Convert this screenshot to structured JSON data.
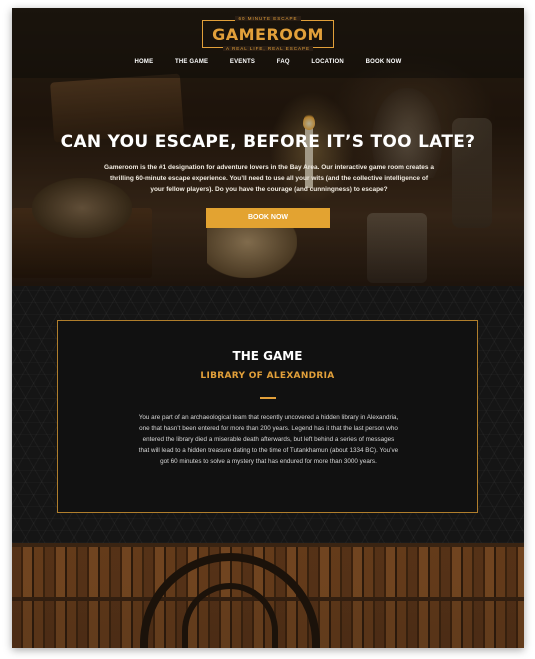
{
  "brand": {
    "tagline_top": "60 MINUTE ESCAPE",
    "name": "GAMEROOM",
    "tagline_bottom": "A REAL LIFE, REAL ESCAPE"
  },
  "nav": {
    "items": [
      "HOME",
      "THE GAME",
      "EVENTS",
      "FAQ",
      "LOCATION",
      "BOOK NOW"
    ]
  },
  "hero": {
    "title": "CAN YOU ESCAPE, BEFORE IT’S TOO LATE?",
    "text": "Gameroom is the #1 designation for adventure lovers in the Bay Area. Our interactive game room creates a thrilling 60-minute escape experience. You’ll need to use all your wits (and the collective intelligence of your fellow players). Do you have the courage (and cunningness) to escape?",
    "button": "BOOK NOW"
  },
  "game": {
    "title": "THE GAME",
    "subtitle": "LIBRARY OF ALEXANDRIA",
    "text": "You are part of an archaeological team that recently uncovered a hidden library in Alexandria, one that hasn’t been entered for more than 200 years. Legend has it that the last person who entered the library died a miserable death afterwards, but left behind a series of messages that will lead to a hidden treasure dating to the time of Tutankhamun (about 1334 BC). You’ve got 60 minutes to solve a mystery that has endured for more than 3000 years."
  },
  "colors": {
    "accent": "#e2a03a",
    "button": "#e3a331",
    "dark_bg": "#111111"
  }
}
